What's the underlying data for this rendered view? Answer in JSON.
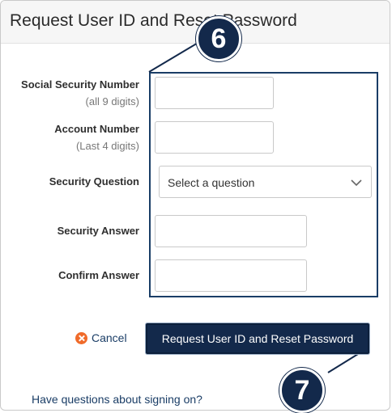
{
  "header": {
    "title": "Request User ID and Reset Password"
  },
  "form": {
    "ssn": {
      "label": "Social Security Number",
      "hint": "(all 9 digits)",
      "value": ""
    },
    "account": {
      "label": "Account Number",
      "hint": "(Last 4 digits)",
      "value": ""
    },
    "question": {
      "label": "Security Question",
      "selected": "Select a question",
      "icon": "chevron-down-icon"
    },
    "answer": {
      "label": "Security Answer",
      "value": ""
    },
    "confirm": {
      "label": "Confirm Answer",
      "value": ""
    }
  },
  "actions": {
    "cancel_label": "Cancel",
    "cancel_icon": "close-circle-icon",
    "submit_label": "Request User ID and Reset Password"
  },
  "help": {
    "link_text": "Have questions about signing on?"
  },
  "callouts": {
    "form_step": "6",
    "submit_step": "7"
  },
  "colors": {
    "brand_navy": "#13294b",
    "cancel_orange": "#f06b2a",
    "link_blue": "#1a3d66"
  }
}
